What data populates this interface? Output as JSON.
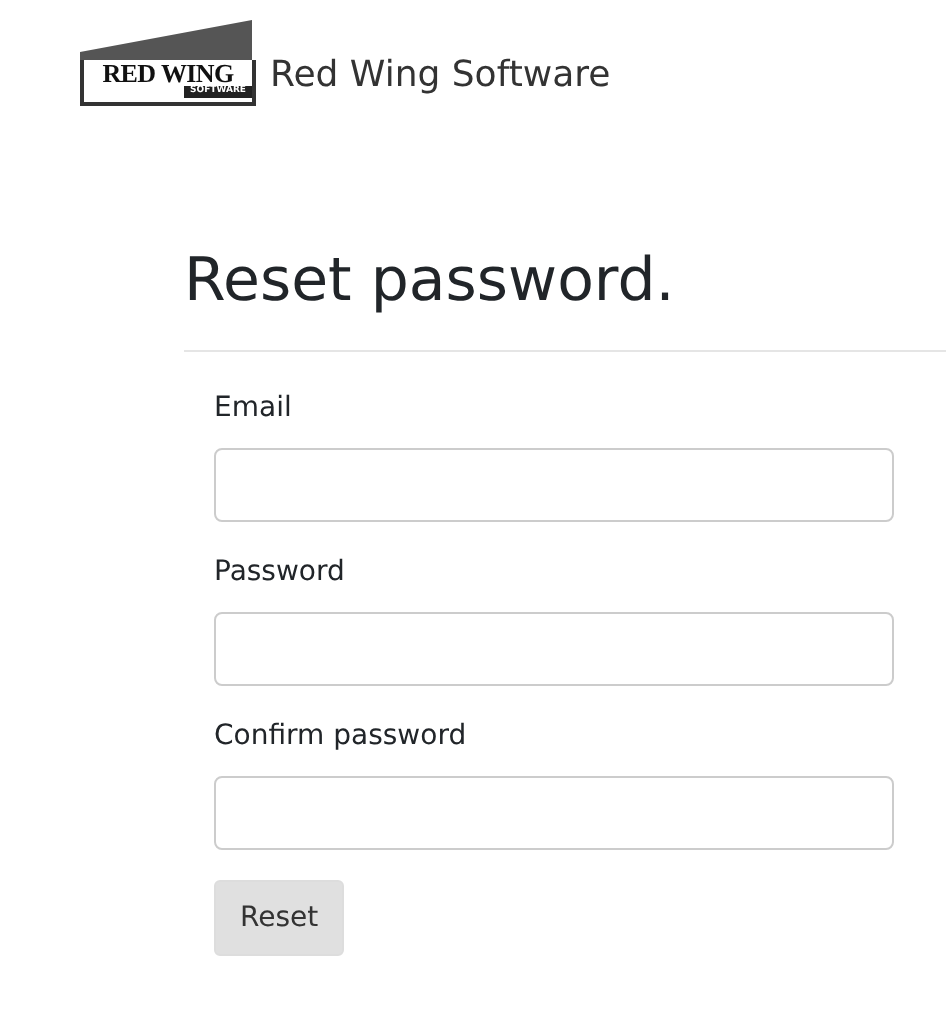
{
  "header": {
    "logo": {
      "wordmark": "RED WING",
      "tagline": "SOFTWARE"
    },
    "brand": "Red Wing Software"
  },
  "heading": "Reset password.",
  "fields": [
    {
      "label": "Email"
    },
    {
      "label": "Password"
    },
    {
      "label": "Confirm password"
    }
  ],
  "buttons": [
    "Reset"
  ]
}
